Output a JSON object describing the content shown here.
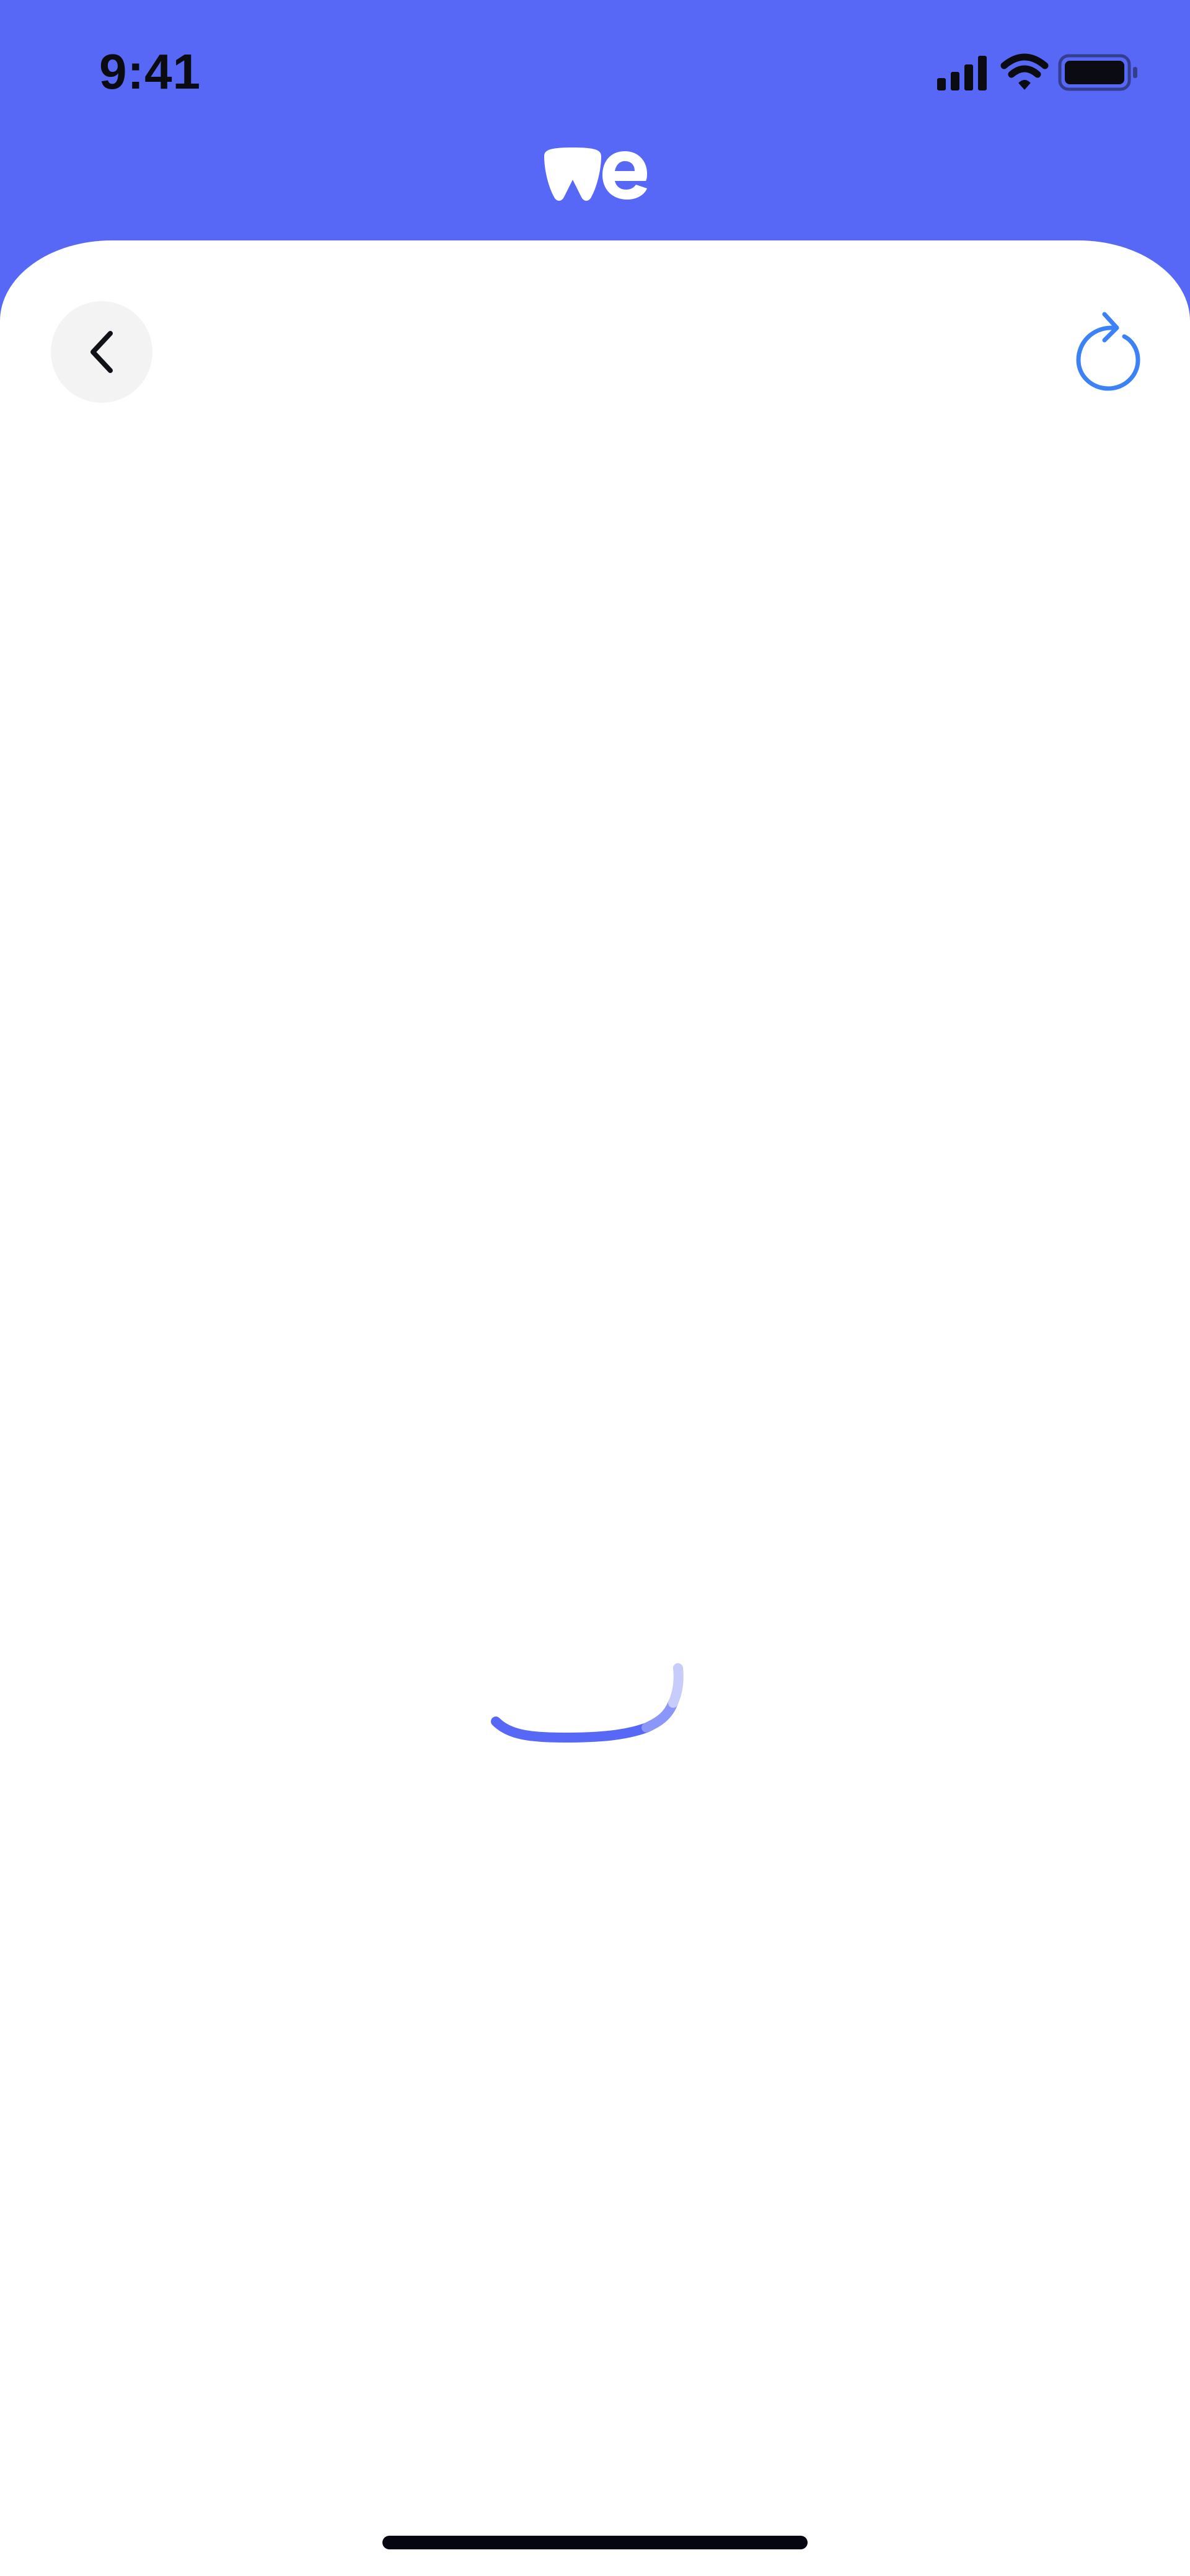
{
  "status_bar": {
    "time": "9:41"
  },
  "header": {
    "logo": "wetransfer-logo",
    "background_color": "#5768f6"
  },
  "toolbar": {
    "back_icon": "chevron-left-icon",
    "refresh_icon": "refresh-icon",
    "refresh_color": "#3b82f6"
  },
  "content": {
    "loading_indicator": "spinner",
    "accent_color": "#5768f6"
  }
}
